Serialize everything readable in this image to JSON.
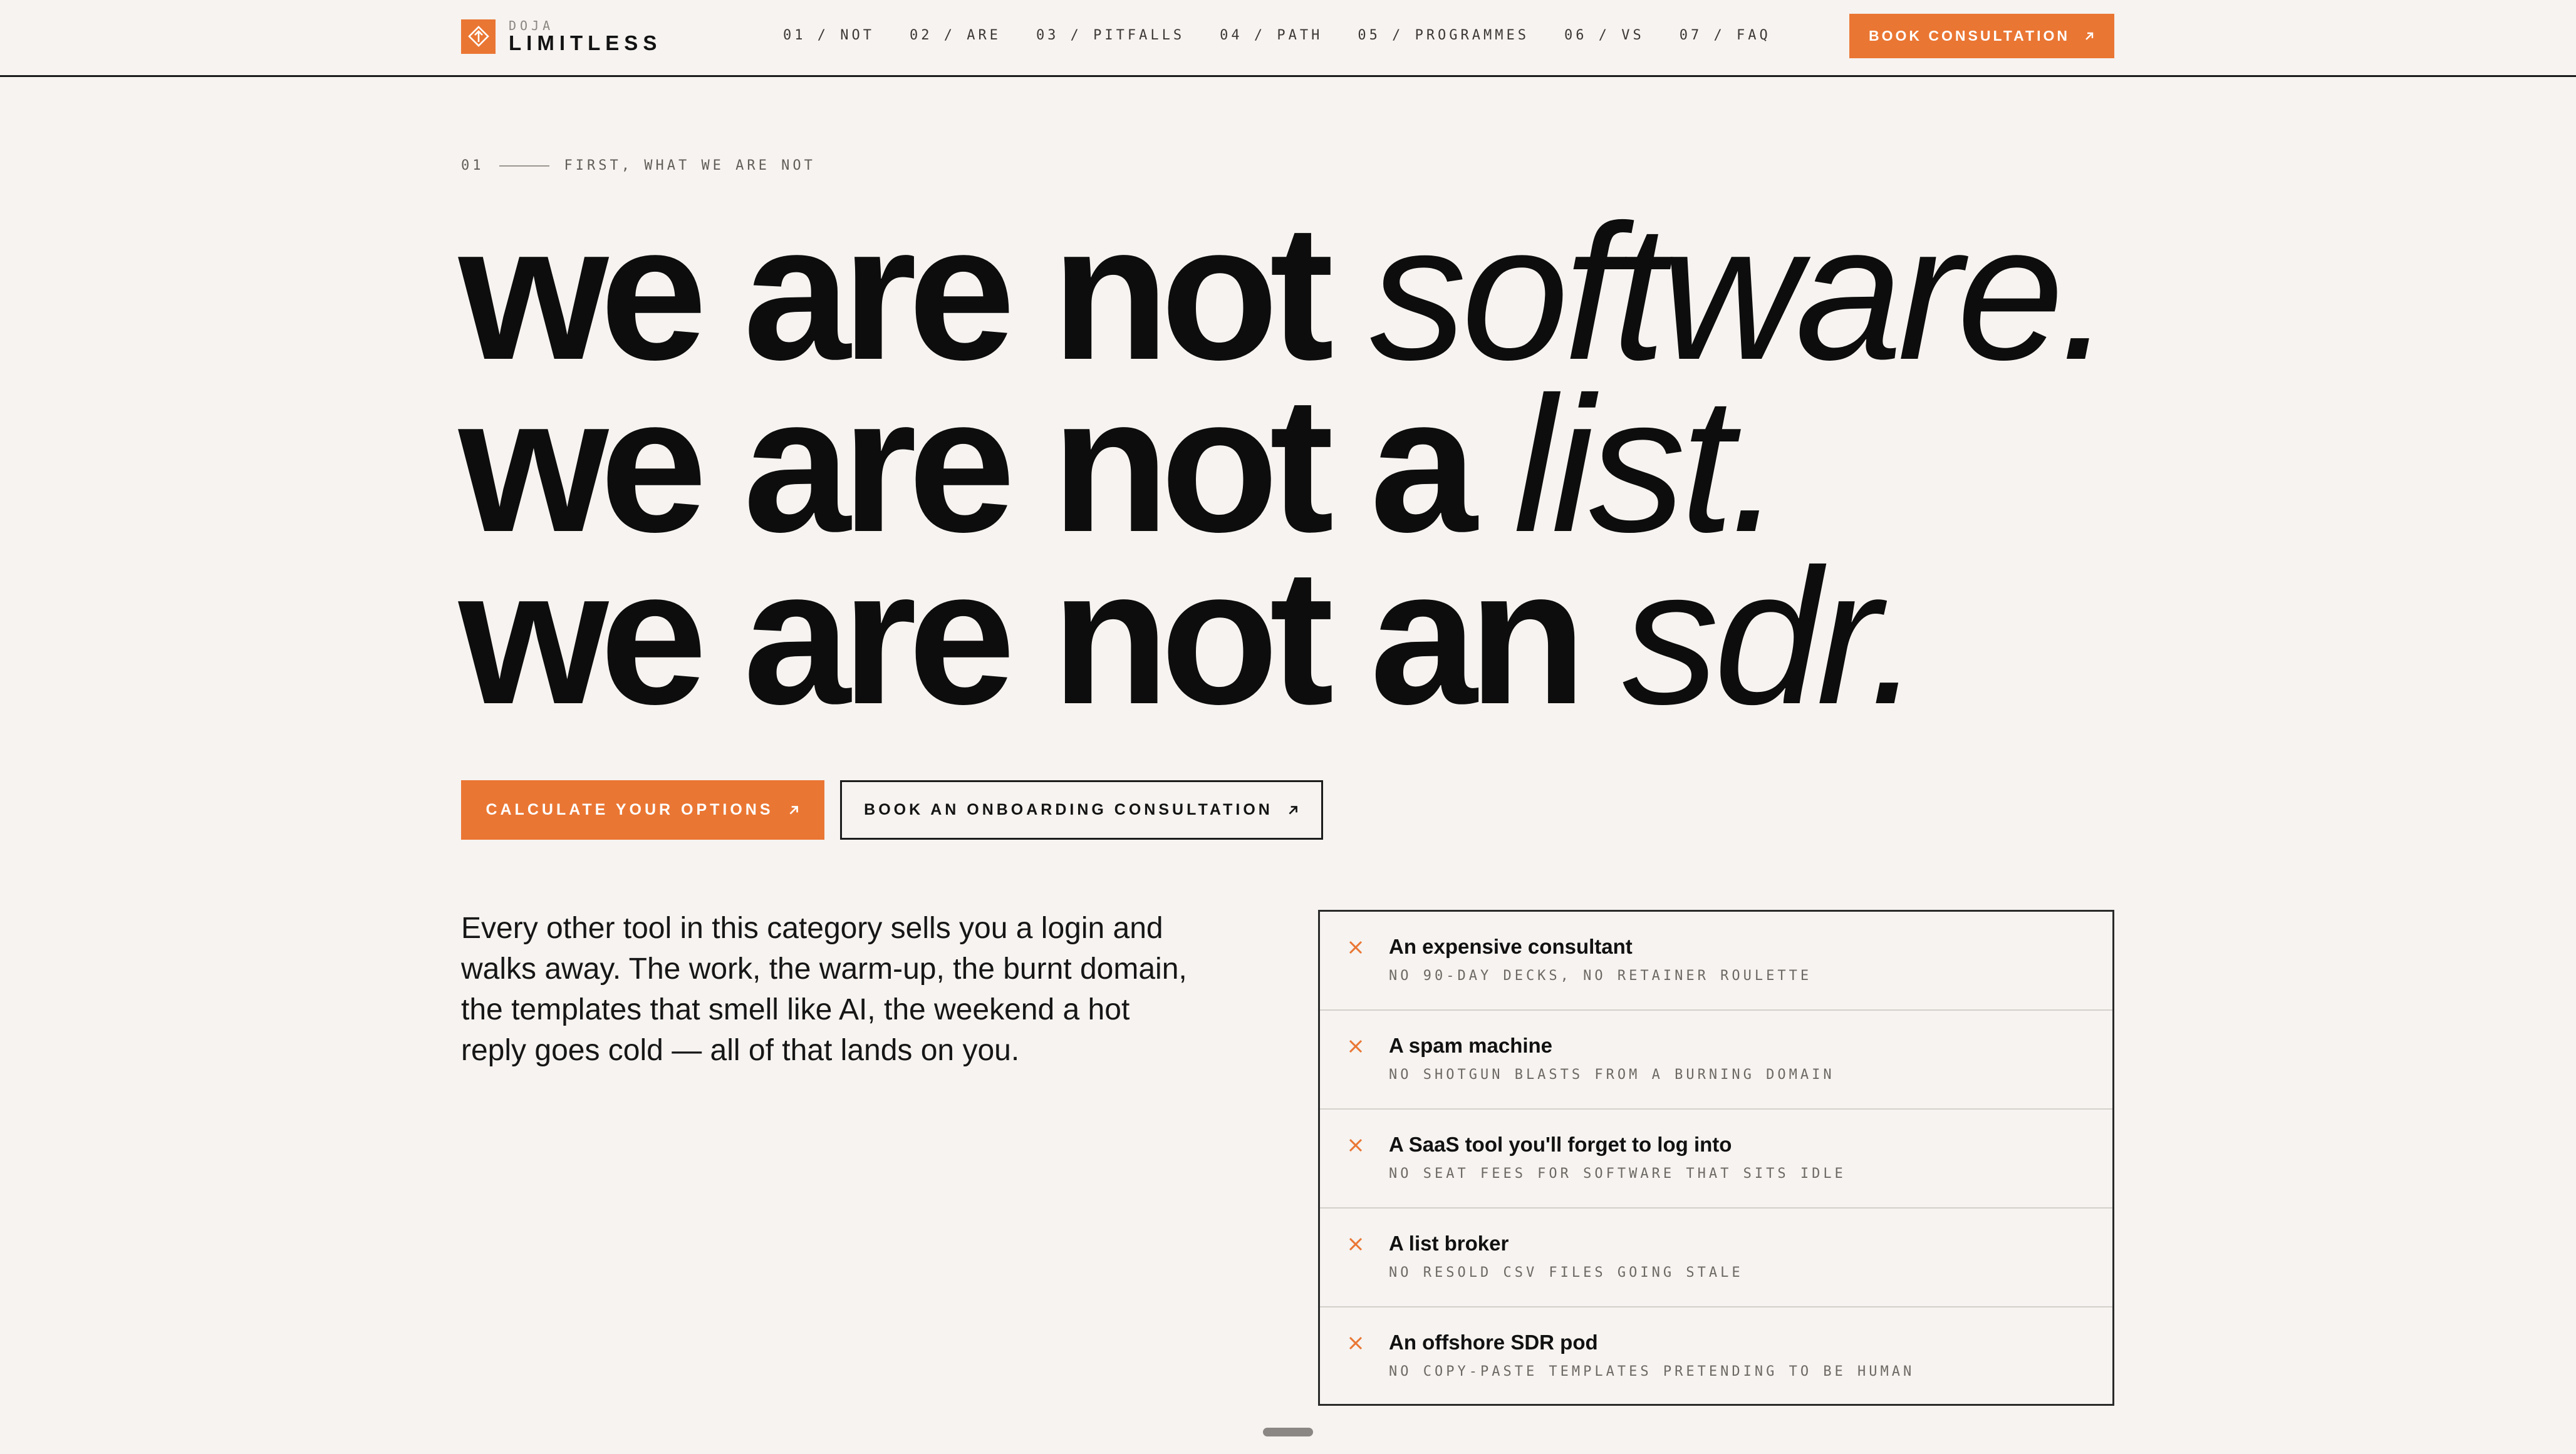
{
  "brand": {
    "top_label": "DOJA",
    "name": "LIMITLESS",
    "logo_icon": "diamond-arrow-icon",
    "accent_color": "#ea7633"
  },
  "nav": {
    "items": [
      {
        "label": "01 / NOT"
      },
      {
        "label": "02 / ARE"
      },
      {
        "label": "03 / PITFALLS"
      },
      {
        "label": "04 / PATH"
      },
      {
        "label": "05 / PROGRAMMES"
      },
      {
        "label": "06 / VS"
      },
      {
        "label": "07 / FAQ"
      }
    ],
    "cta_label": "BOOK CONSULTATION"
  },
  "section": {
    "number": "01",
    "eyebrow": "FIRST, WHAT WE ARE NOT"
  },
  "headline": {
    "line1_bold": "we are not",
    "line1_italic": "software.",
    "line2_bold": "we are not a",
    "line2_italic": "list.",
    "line3_bold": "we are not an",
    "line3_italic": "sdr."
  },
  "actions": {
    "primary_label": "CALCULATE YOUR OPTIONS",
    "secondary_label": "BOOK AN ONBOARDING CONSULTATION"
  },
  "body": {
    "lede": "Every other tool in this category sells you a login and walks away. The work, the warm-up, the burnt domain, the templates that smell like AI, the weekend a hot reply goes cold — all of that lands on you."
  },
  "not_list": {
    "items": [
      {
        "title": "An expensive consultant",
        "subtitle": "NO 90-DAY DECKS, NO RETAINER ROULETTE"
      },
      {
        "title": "A spam machine",
        "subtitle": "NO SHOTGUN BLASTS FROM A BURNING DOMAIN"
      },
      {
        "title": "A SaaS tool you'll forget to log into",
        "subtitle": "NO SEAT FEES FOR SOFTWARE THAT SITS IDLE"
      },
      {
        "title": "A list broker",
        "subtitle": "NO RESOLD CSV FILES GOING STALE"
      },
      {
        "title": "An offshore SDR pod",
        "subtitle": "NO COPY-PASTE TEMPLATES PRETENDING TO BE HUMAN"
      }
    ]
  }
}
